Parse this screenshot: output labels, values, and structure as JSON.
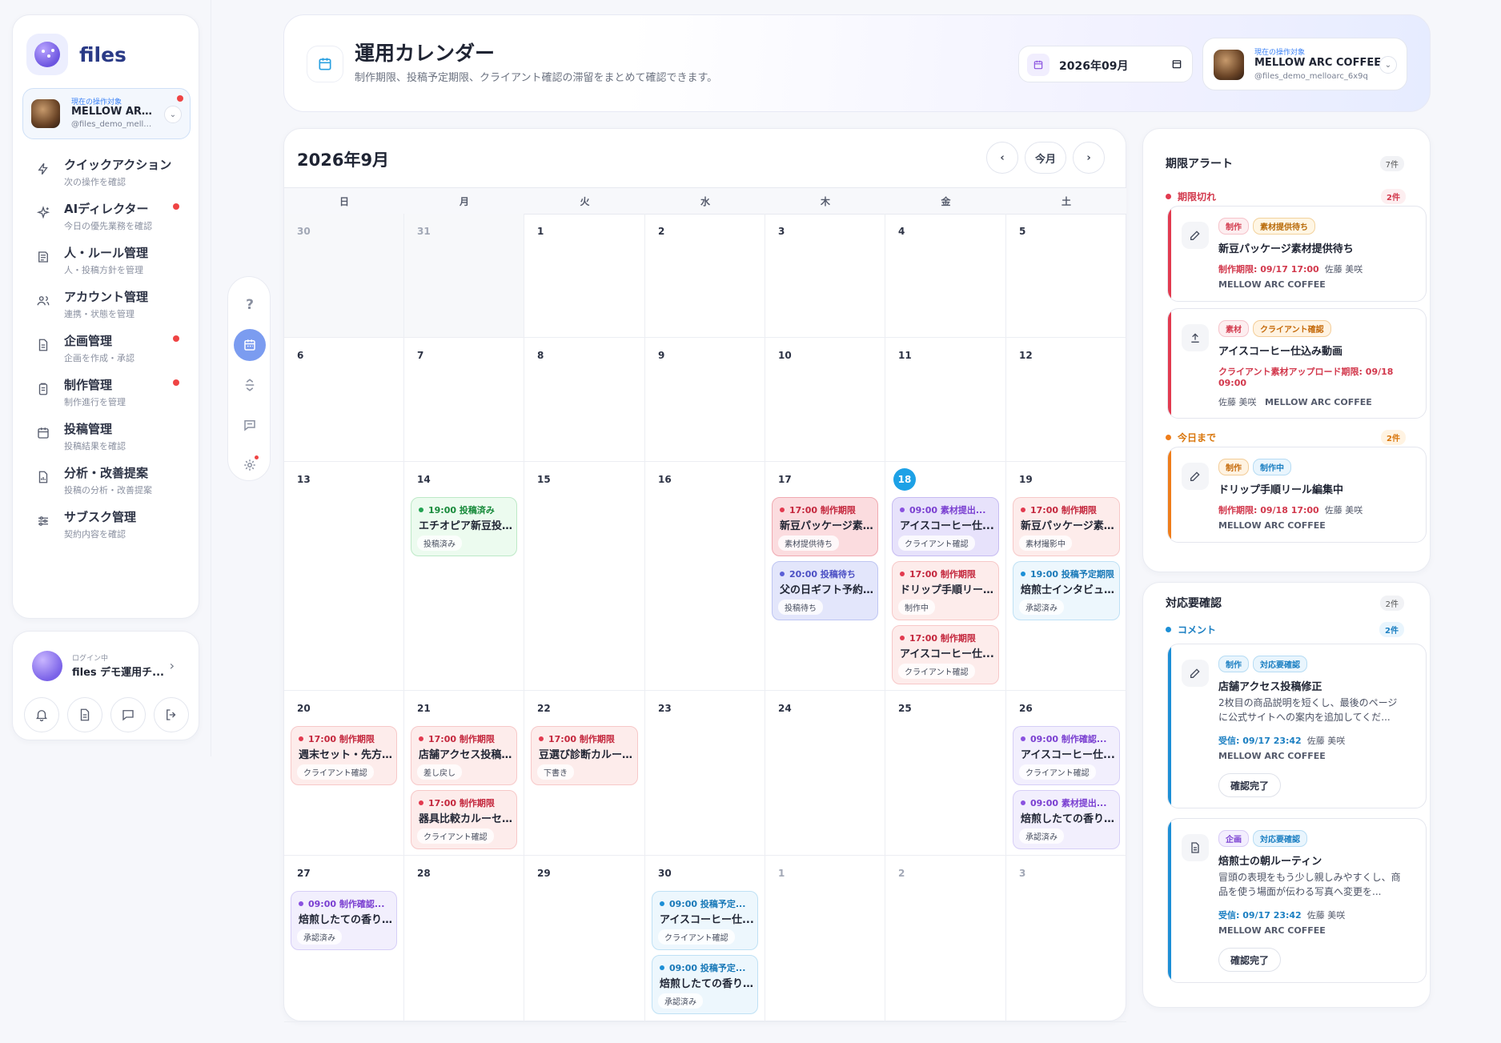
{
  "app": {
    "name": "files"
  },
  "current_account": {
    "label": "現在の操作対象",
    "name": "MELLOW ARC COFFEE",
    "handle": "@files_demo_melloarc_6x9q"
  },
  "sidebar": {
    "items": [
      {
        "title": "クイックアクション",
        "sub": "次の操作を確認",
        "icon": "bolt-icon",
        "dot": false
      },
      {
        "title": "AIディレクター",
        "sub": "今日の優先業務を確認",
        "icon": "sparkle-icon",
        "dot": true
      },
      {
        "title": "人・ルール管理",
        "sub": "人・投稿方針を管理",
        "icon": "book-icon",
        "dot": false
      },
      {
        "title": "アカウント管理",
        "sub": "連携・状態を管理",
        "icon": "users-icon",
        "dot": false
      },
      {
        "title": "企画管理",
        "sub": "企画を作成・承認",
        "icon": "document-icon",
        "dot": true
      },
      {
        "title": "制作管理",
        "sub": "制作進行を管理",
        "icon": "clipboard-icon",
        "dot": true
      },
      {
        "title": "投稿管理",
        "sub": "投稿結果を確認",
        "icon": "calendar-icon",
        "dot": false
      },
      {
        "title": "分析・改善提案",
        "sub": "投稿の分析・改善提案",
        "icon": "chart-doc-icon",
        "dot": false
      },
      {
        "title": "サブスク管理",
        "sub": "契約内容を確認",
        "icon": "sliders-icon",
        "dot": false
      }
    ]
  },
  "user": {
    "label": "ログイン中",
    "name": "files デモ運用チ..."
  },
  "header": {
    "title": "運用カレンダー",
    "subtitle": "制作期限、投稿予定期限、クライアント確認の滞留をまとめて確認できます。",
    "month_value": "2026年09月"
  },
  "calendar": {
    "title": "2026年9月",
    "today_label": "今月",
    "weekdays": [
      "日",
      "月",
      "火",
      "水",
      "木",
      "金",
      "土"
    ],
    "weeks": [
      [
        {
          "d": "30",
          "out": true,
          "ev": []
        },
        {
          "d": "31",
          "out": true,
          "ev": []
        },
        {
          "d": "1",
          "ev": []
        },
        {
          "d": "2",
          "ev": []
        },
        {
          "d": "3",
          "ev": []
        },
        {
          "d": "4",
          "ev": []
        },
        {
          "d": "5",
          "ev": []
        }
      ],
      [
        {
          "d": "6",
          "ev": []
        },
        {
          "d": "7",
          "ev": []
        },
        {
          "d": "8",
          "ev": []
        },
        {
          "d": "9",
          "ev": []
        },
        {
          "d": "10",
          "ev": []
        },
        {
          "d": "11",
          "ev": []
        },
        {
          "d": "12",
          "ev": []
        }
      ],
      [
        {
          "d": "13",
          "ev": []
        },
        {
          "d": "14",
          "ev": [
            {
              "time": "19:00 投稿済み",
              "title": "エチオピア新豆投...",
              "status": "投稿済み",
              "c": "green"
            }
          ]
        },
        {
          "d": "15",
          "ev": []
        },
        {
          "d": "16",
          "ev": []
        },
        {
          "d": "17",
          "ev": [
            {
              "time": "17:00 制作期限",
              "title": "新豆パッケージ素...",
              "status": "素材提供待ち",
              "c": "redd"
            },
            {
              "time": "20:00 投稿待ち",
              "title": "父の日ギフト予約...",
              "status": "投稿待ち",
              "c": "indigo"
            }
          ]
        },
        {
          "d": "18",
          "today": true,
          "ev": [
            {
              "time": "09:00 素材提出...",
              "title": "アイスコーヒー仕...",
              "status": "クライアント確認",
              "c": "purpled"
            },
            {
              "time": "17:00 制作期限",
              "title": "ドリップ手順リー...",
              "status": "制作中",
              "c": "red"
            },
            {
              "time": "17:00 制作期限",
              "title": "アイスコーヒー仕...",
              "status": "クライアント確認",
              "c": "red"
            }
          ]
        },
        {
          "d": "19",
          "ev": [
            {
              "time": "17:00 制作期限",
              "title": "新豆パッケージ素...",
              "status": "素材撮影中",
              "c": "red"
            },
            {
              "time": "19:00 投稿予定期限",
              "title": "焙煎士インタビュ...",
              "status": "承認済み",
              "c": "blue"
            }
          ]
        }
      ],
      [
        {
          "d": "20",
          "ev": [
            {
              "time": "17:00 制作期限",
              "title": "週末セット・先方...",
              "status": "クライアント確認",
              "c": "red"
            }
          ]
        },
        {
          "d": "21",
          "ev": [
            {
              "time": "17:00 制作期限",
              "title": "店舗アクセス投稿...",
              "status": "差し戻し",
              "c": "red"
            },
            {
              "time": "17:00 制作期限",
              "title": "器具比較カルーセ...",
              "status": "クライアント確認",
              "c": "red"
            }
          ]
        },
        {
          "d": "22",
          "ev": [
            {
              "time": "17:00 制作期限",
              "title": "豆選び診断カルー...",
              "status": "下書き",
              "c": "red"
            }
          ]
        },
        {
          "d": "23",
          "ev": []
        },
        {
          "d": "24",
          "ev": []
        },
        {
          "d": "25",
          "ev": []
        },
        {
          "d": "26",
          "ev": [
            {
              "time": "09:00 制作確認...",
              "title": "アイスコーヒー仕...",
              "status": "クライアント確認",
              "c": "purple"
            },
            {
              "time": "09:00 素材提出...",
              "title": "焙煎したての香り...",
              "status": "承認済み",
              "c": "purple"
            }
          ]
        }
      ],
      [
        {
          "d": "27",
          "ev": [
            {
              "time": "09:00 制作確認...",
              "title": "焙煎したての香り...",
              "status": "承認済み",
              "c": "purple"
            }
          ]
        },
        {
          "d": "28",
          "ev": []
        },
        {
          "d": "29",
          "ev": []
        },
        {
          "d": "30",
          "ev": [
            {
              "time": "09:00 投稿予定...",
              "title": "アイスコーヒー仕...",
              "status": "クライアント確認",
              "c": "blue"
            },
            {
              "time": "09:00 投稿予定...",
              "title": "焙煎したての香り...",
              "status": "承認済み",
              "c": "blue"
            }
          ]
        },
        {
          "d": "1",
          "faded": true,
          "ev": []
        },
        {
          "d": "2",
          "faded": true,
          "ev": []
        },
        {
          "d": "3",
          "faded": true,
          "ev": []
        }
      ]
    ]
  },
  "alerts": {
    "title": "期限アラート",
    "count": "7件",
    "overdue": {
      "label": "期限切れ",
      "count": "2件"
    },
    "today": {
      "label": "今日まで",
      "count": "2件"
    },
    "cards": [
      {
        "chips": [
          "制作",
          "素材提供待ち"
        ],
        "title": "新豆パッケージ素材提供待ち",
        "deadline": "制作期限: 09/17 17:00",
        "person": "佐藤 美咲",
        "org": "MELLOW ARC COFFEE"
      },
      {
        "chips": [
          "素材",
          "クライアント確認"
        ],
        "title": "アイスコーヒー仕込み動画",
        "deadline1": "クライアント素材アップロード期限: 09/18",
        "deadline2": "09:00",
        "person": "佐藤 美咲",
        "org": "MELLOW ARC COFFEE"
      },
      {
        "chips": [
          "制作",
          "制作中"
        ],
        "title": "ドリップ手順リール編集中",
        "deadline": "制作期限: 09/18 17:00",
        "person": "佐藤 美咲",
        "org": "MELLOW ARC COFFEE"
      }
    ]
  },
  "review": {
    "title": "対応要確認",
    "count": "2件",
    "section": {
      "label": "コメント",
      "count": "2件"
    },
    "cards": [
      {
        "chips": [
          "制作",
          "対応要確認"
        ],
        "title": "店舗アクセス投稿修正",
        "desc": "2枚目の商品説明を短くし、最後のページに公式サイトへの案内を追加してくだ...",
        "received": "受信: 09/17 23:42",
        "person": "佐藤 美咲",
        "org": "MELLOW ARC COFFEE",
        "button": "確認完了"
      },
      {
        "chips": [
          "企画",
          "対応要確認"
        ],
        "title": "焙煎士の朝ルーティン",
        "desc": "冒頭の表現をもう少し親しみやすくし、商品を使う場面が伝わる写真へ変更を...",
        "received": "受信: 09/17 23:42",
        "person": "佐藤 美咲",
        "org": "MELLOW ARC COFFEE",
        "button": "確認完了"
      }
    ]
  },
  "tools": {
    "help": "?"
  }
}
